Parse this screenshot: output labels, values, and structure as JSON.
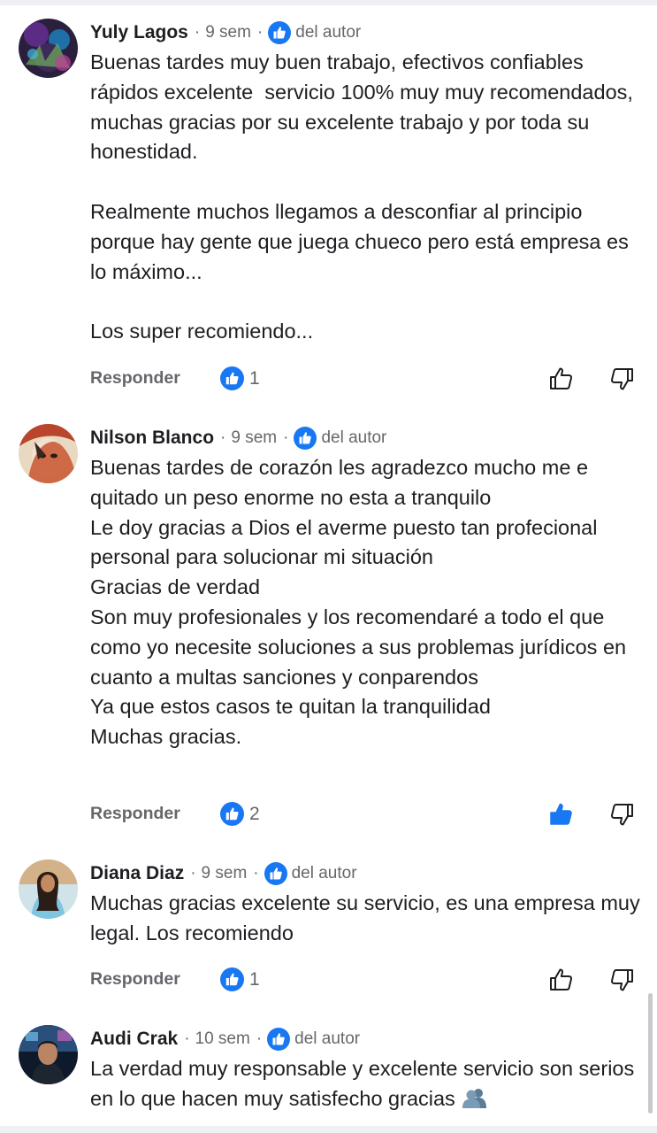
{
  "colors": {
    "accent": "#1877f2",
    "secondary_text": "#65676b",
    "primary_text": "#1c1e21"
  },
  "icons": {
    "author_badge": "thumbs-up-circle-icon",
    "reaction": "like-reaction-icon",
    "like_button": "thumbs-up-outline-icon",
    "like_button_active": "thumbs-up-filled-icon",
    "dislike_button": "thumbs-down-outline-icon"
  },
  "comments": [
    {
      "author": "Yuly Lagos",
      "time": "9 sem",
      "badge": "del autor",
      "text": "Buenas tardes muy buen trabajo, efectivos confiables rápidos excelente  servicio 100% muy muy recomendados, muchas gracias por su excelente trabajo y por toda su honestidad.\n\nRealmente muchos llegamos a desconfiar al principio porque hay gente que juega chueco pero está empresa es lo máximo...\n\nLos super recomiendo...",
      "reply_label": "Responder",
      "likes": "1",
      "liked": false
    },
    {
      "author": "Nilson Blanco",
      "time": "9 sem",
      "badge": "del autor",
      "text": "Buenas tardes de corazón les agradezco mucho me e quitado un peso enorme no esta a tranquilo\nLe doy gracias a Dios el averme puesto tan profecional personal para solucionar mi situación\nGracias de verdad\nSon muy profesionales y los recomendaré a todo el que como yo necesite soluciones a sus problemas jurídicos en cuanto a multas sanciones y conparendos\nYa que estos casos te quitan la tranquilidad\nMuchas gracias.",
      "reply_label": "Responder",
      "likes": "2",
      "liked": true
    },
    {
      "author": "Diana Diaz",
      "time": "9 sem",
      "badge": "del autor",
      "text": "Muchas gracias excelente su servicio, es una empresa muy legal. Los recomiendo",
      "reply_label": "Responder",
      "likes": "1",
      "liked": false
    },
    {
      "author": "Audi Crak",
      "time": "10 sem",
      "badge": "del autor",
      "text": "La verdad muy responsable y excelente servicio son serios en lo que hacen muy satisfecho gracias",
      "emoji": "busts-in-silhouette-icon"
    }
  ]
}
